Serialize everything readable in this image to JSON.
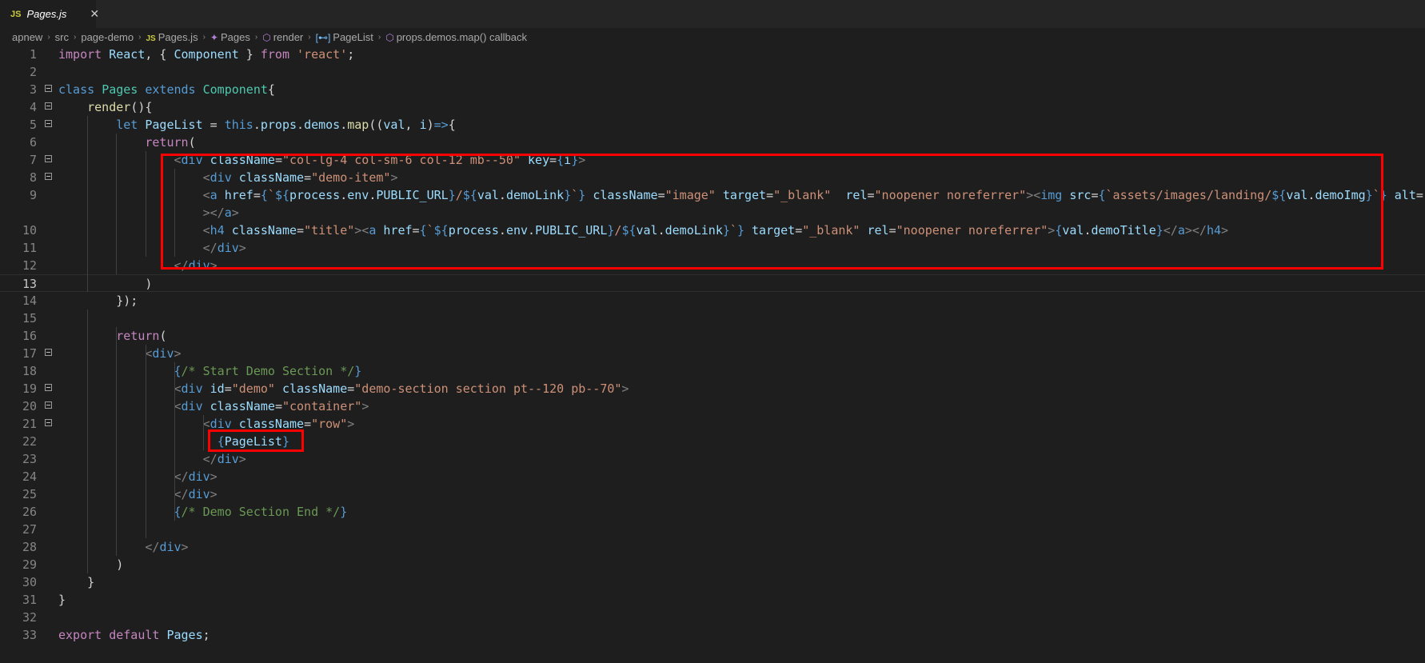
{
  "tab": {
    "icon": "JS",
    "title": "Pages.js",
    "close": "✕"
  },
  "breadcrumb": [
    {
      "label": "apnew"
    },
    {
      "label": "src"
    },
    {
      "label": "page-demo"
    },
    {
      "label": "Pages.js",
      "icon": "JS"
    },
    {
      "label": "Pages",
      "icon": "✦"
    },
    {
      "label": "render",
      "icon": "⬡"
    },
    {
      "label": "PageList",
      "icon": "[⊷]"
    },
    {
      "label": "props.demos.map() callback",
      "icon": "⬡"
    }
  ],
  "editor": {
    "current_line": 13,
    "lines": [
      {
        "n": "1",
        "code": [
          [
            "k",
            "import "
          ],
          [
            "v",
            "React"
          ],
          [
            "p",
            ", { "
          ],
          [
            "v",
            "Component"
          ],
          [
            "p",
            " } "
          ],
          [
            "k",
            "from "
          ],
          [
            "s",
            "'react'"
          ],
          [
            "p",
            ";"
          ]
        ]
      },
      {
        "n": "2",
        "code": []
      },
      {
        "n": "3",
        "fold": true,
        "code": [
          [
            "b",
            "class "
          ],
          [
            "c",
            "Pages "
          ],
          [
            "b",
            "extends "
          ],
          [
            "c",
            "Component"
          ],
          [
            "p",
            "{"
          ]
        ]
      },
      {
        "n": "4",
        "fold": true,
        "code": [
          [
            "p",
            "    "
          ],
          [
            "f",
            "render"
          ],
          [
            "p",
            "(){"
          ]
        ]
      },
      {
        "n": "5",
        "fold": true,
        "code": [
          [
            "p",
            "        "
          ],
          [
            "b",
            "let "
          ],
          [
            "v",
            "PageList"
          ],
          [
            "p",
            " = "
          ],
          [
            "b",
            "this"
          ],
          [
            "p",
            "."
          ],
          [
            "v",
            "props"
          ],
          [
            "p",
            "."
          ],
          [
            "v",
            "demos"
          ],
          [
            "p",
            "."
          ],
          [
            "f",
            "map"
          ],
          [
            "p",
            "(("
          ],
          [
            "v",
            "val"
          ],
          [
            "p",
            ", "
          ],
          [
            "v",
            "i"
          ],
          [
            "p",
            ")"
          ],
          [
            "b",
            "=>"
          ],
          [
            "p",
            "{"
          ]
        ]
      },
      {
        "n": "6",
        "code": [
          [
            "p",
            "            "
          ],
          [
            "k",
            "return"
          ],
          [
            "p",
            "("
          ]
        ]
      },
      {
        "n": "7",
        "fold": true,
        "code": [
          [
            "p",
            "                "
          ],
          [
            "t",
            "<"
          ],
          [
            "b",
            "div "
          ],
          [
            "v",
            "className"
          ],
          [
            "p",
            "="
          ],
          [
            "s",
            "\"col-lg-4 col-sm-6 col-12 mb--50\" "
          ],
          [
            "v",
            "key"
          ],
          [
            "p",
            "="
          ],
          [
            "b",
            "{"
          ],
          [
            "v",
            "i"
          ],
          [
            "b",
            "}"
          ],
          [
            "t",
            ">"
          ]
        ]
      },
      {
        "n": "8",
        "fold": true,
        "code": [
          [
            "p",
            "                    "
          ],
          [
            "t",
            "<"
          ],
          [
            "b",
            "div "
          ],
          [
            "v",
            "className"
          ],
          [
            "p",
            "="
          ],
          [
            "s",
            "\"demo-item\""
          ],
          [
            "t",
            ">"
          ]
        ]
      },
      {
        "n": "9",
        "code": [
          [
            "p",
            "                    "
          ],
          [
            "t",
            "<"
          ],
          [
            "b",
            "a "
          ],
          [
            "v",
            "href"
          ],
          [
            "p",
            "="
          ],
          [
            "b",
            "{"
          ],
          [
            "s",
            "`"
          ],
          [
            "b",
            "${"
          ],
          [
            "v",
            "process"
          ],
          [
            "p",
            "."
          ],
          [
            "v",
            "env"
          ],
          [
            "p",
            "."
          ],
          [
            "v",
            "PUBLIC_URL"
          ],
          [
            "b",
            "}"
          ],
          [
            "s",
            "/"
          ],
          [
            "b",
            "${"
          ],
          [
            "v",
            "val"
          ],
          [
            "p",
            "."
          ],
          [
            "v",
            "demoLink"
          ],
          [
            "b",
            "}"
          ],
          [
            "s",
            "`"
          ],
          [
            "b",
            "} "
          ],
          [
            "v",
            "className"
          ],
          [
            "p",
            "="
          ],
          [
            "s",
            "\"image\" "
          ],
          [
            "v",
            "target"
          ],
          [
            "p",
            "="
          ],
          [
            "s",
            "\"_blank\"  "
          ],
          [
            "v",
            "rel"
          ],
          [
            "p",
            "="
          ],
          [
            "s",
            "\"noopener noreferrer\""
          ],
          [
            "t",
            "><"
          ],
          [
            "b",
            "img "
          ],
          [
            "v",
            "src"
          ],
          [
            "p",
            "="
          ],
          [
            "b",
            "{"
          ],
          [
            "s",
            "`assets/images/landing/"
          ],
          [
            "b",
            "${"
          ],
          [
            "v",
            "val"
          ],
          [
            "p",
            "."
          ],
          [
            "v",
            "demoImg"
          ],
          [
            "b",
            "}"
          ],
          [
            "s",
            "`"
          ],
          [
            "b",
            "} "
          ],
          [
            "v",
            "alt"
          ],
          [
            "p",
            "="
          ],
          [
            "s",
            "\"\" "
          ],
          [
            "t",
            "/"
          ]
        ]
      },
      {
        "n": "",
        "code": [
          [
            "p",
            "                    "
          ],
          [
            "t",
            "></"
          ],
          [
            "b",
            "a"
          ],
          [
            "t",
            ">"
          ]
        ]
      },
      {
        "n": "10",
        "code": [
          [
            "p",
            "                    "
          ],
          [
            "t",
            "<"
          ],
          [
            "b",
            "h4 "
          ],
          [
            "v",
            "className"
          ],
          [
            "p",
            "="
          ],
          [
            "s",
            "\"title\""
          ],
          [
            "t",
            "><"
          ],
          [
            "b",
            "a "
          ],
          [
            "v",
            "href"
          ],
          [
            "p",
            "="
          ],
          [
            "b",
            "{"
          ],
          [
            "s",
            "`"
          ],
          [
            "b",
            "${"
          ],
          [
            "v",
            "process"
          ],
          [
            "p",
            "."
          ],
          [
            "v",
            "env"
          ],
          [
            "p",
            "."
          ],
          [
            "v",
            "PUBLIC_URL"
          ],
          [
            "b",
            "}"
          ],
          [
            "s",
            "/"
          ],
          [
            "b",
            "${"
          ],
          [
            "v",
            "val"
          ],
          [
            "p",
            "."
          ],
          [
            "v",
            "demoLink"
          ],
          [
            "b",
            "}"
          ],
          [
            "s",
            "`"
          ],
          [
            "b",
            "} "
          ],
          [
            "v",
            "target"
          ],
          [
            "p",
            "="
          ],
          [
            "s",
            "\"_blank\" "
          ],
          [
            "v",
            "rel"
          ],
          [
            "p",
            "="
          ],
          [
            "s",
            "\"noopener noreferrer\""
          ],
          [
            "t",
            ">"
          ],
          [
            "b",
            "{"
          ],
          [
            "v",
            "val"
          ],
          [
            "p",
            "."
          ],
          [
            "v",
            "demoTitle"
          ],
          [
            "b",
            "}"
          ],
          [
            "t",
            "</"
          ],
          [
            "b",
            "a"
          ],
          [
            "t",
            "></"
          ],
          [
            "b",
            "h4"
          ],
          [
            "t",
            ">"
          ]
        ]
      },
      {
        "n": "11",
        "code": [
          [
            "p",
            "                    "
          ],
          [
            "t",
            "</"
          ],
          [
            "b",
            "div"
          ],
          [
            "t",
            ">"
          ]
        ]
      },
      {
        "n": "12",
        "code": [
          [
            "p",
            "                "
          ],
          [
            "t",
            "</"
          ],
          [
            "b",
            "div"
          ],
          [
            "t",
            ">"
          ]
        ]
      },
      {
        "n": "13",
        "code": [
          [
            "p",
            "            "
          ],
          [
            "p",
            ")"
          ]
        ]
      },
      {
        "n": "14",
        "code": [
          [
            "p",
            "        "
          ],
          [
            "p",
            "});"
          ]
        ]
      },
      {
        "n": "15",
        "code": []
      },
      {
        "n": "16",
        "code": [
          [
            "p",
            "        "
          ],
          [
            "k",
            "return"
          ],
          [
            "p",
            "("
          ]
        ]
      },
      {
        "n": "17",
        "fold": true,
        "code": [
          [
            "p",
            "            "
          ],
          [
            "t",
            "<"
          ],
          [
            "b",
            "div"
          ],
          [
            "t",
            ">"
          ]
        ]
      },
      {
        "n": "18",
        "code": [
          [
            "p",
            "                "
          ],
          [
            "b",
            "{"
          ],
          [
            "g",
            "/* Start Demo Section */"
          ],
          [
            "b",
            "}"
          ]
        ]
      },
      {
        "n": "19",
        "fold": true,
        "code": [
          [
            "p",
            "                "
          ],
          [
            "t",
            "<"
          ],
          [
            "b",
            "div "
          ],
          [
            "v",
            "id"
          ],
          [
            "p",
            "="
          ],
          [
            "s",
            "\"demo\" "
          ],
          [
            "v",
            "className"
          ],
          [
            "p",
            "="
          ],
          [
            "s",
            "\"demo-section section pt--120 pb--70\""
          ],
          [
            "t",
            ">"
          ]
        ]
      },
      {
        "n": "20",
        "fold": true,
        "code": [
          [
            "p",
            "                "
          ],
          [
            "t",
            "<"
          ],
          [
            "b",
            "div "
          ],
          [
            "v",
            "className"
          ],
          [
            "p",
            "="
          ],
          [
            "s",
            "\"container\""
          ],
          [
            "t",
            ">"
          ]
        ]
      },
      {
        "n": "21",
        "fold": true,
        "code": [
          [
            "p",
            "                    "
          ],
          [
            "t",
            "<"
          ],
          [
            "b",
            "div "
          ],
          [
            "v",
            "className"
          ],
          [
            "p",
            "="
          ],
          [
            "s",
            "\"row\""
          ],
          [
            "t",
            ">"
          ]
        ]
      },
      {
        "n": "22",
        "code": [
          [
            "p",
            "                      "
          ],
          [
            "b",
            "{"
          ],
          [
            "v",
            "PageList"
          ],
          [
            "b",
            "}"
          ]
        ]
      },
      {
        "n": "23",
        "code": [
          [
            "p",
            "                    "
          ],
          [
            "t",
            "</"
          ],
          [
            "b",
            "div"
          ],
          [
            "t",
            ">"
          ]
        ]
      },
      {
        "n": "24",
        "code": [
          [
            "p",
            "                "
          ],
          [
            "t",
            "</"
          ],
          [
            "b",
            "div"
          ],
          [
            "t",
            ">"
          ]
        ]
      },
      {
        "n": "25",
        "code": [
          [
            "p",
            "                "
          ],
          [
            "t",
            "</"
          ],
          [
            "b",
            "div"
          ],
          [
            "t",
            ">"
          ]
        ]
      },
      {
        "n": "26",
        "code": [
          [
            "p",
            "                "
          ],
          [
            "b",
            "{"
          ],
          [
            "g",
            "/* Demo Section End */"
          ],
          [
            "b",
            "}"
          ]
        ]
      },
      {
        "n": "27",
        "code": []
      },
      {
        "n": "28",
        "code": [
          [
            "p",
            "            "
          ],
          [
            "t",
            "</"
          ],
          [
            "b",
            "div"
          ],
          [
            "t",
            ">"
          ]
        ]
      },
      {
        "n": "29",
        "code": [
          [
            "p",
            "        "
          ],
          [
            "p",
            ")"
          ]
        ]
      },
      {
        "n": "30",
        "code": [
          [
            "p",
            "    "
          ],
          [
            "p",
            "}"
          ]
        ]
      },
      {
        "n": "31",
        "code": [
          [
            "p",
            "}"
          ]
        ]
      },
      {
        "n": "32",
        "code": []
      },
      {
        "n": "33",
        "code": [
          [
            "k",
            "export "
          ],
          [
            "k",
            "default "
          ],
          [
            "v",
            "Pages"
          ],
          [
            "p",
            ";"
          ]
        ]
      }
    ]
  },
  "colors": {
    "background": "#1e1e1e",
    "highlight_box": "#ff0000",
    "keyword": "#c586c0",
    "storage": "#569cd6",
    "class": "#4ec9b0",
    "variable": "#9cdcfe",
    "function": "#dcdcaa",
    "string": "#ce9178",
    "comment": "#6a9955"
  }
}
